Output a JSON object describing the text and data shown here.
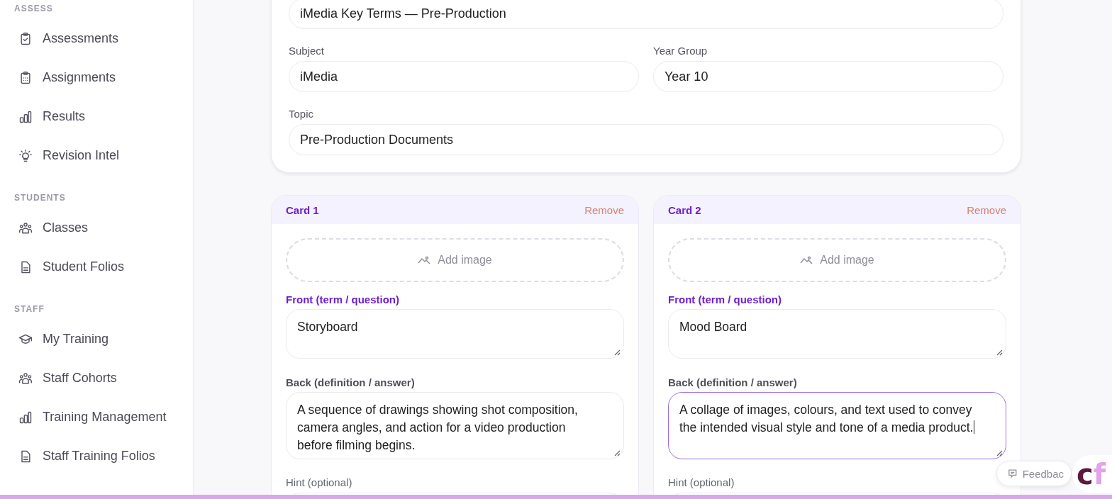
{
  "sidebar": {
    "sections": [
      {
        "heading": "ASSESS",
        "items": [
          {
            "label": "Assessments",
            "kind": "clipboard"
          },
          {
            "label": "Assignments",
            "kind": "checklist"
          },
          {
            "label": "Results",
            "kind": "chart"
          },
          {
            "label": "Revision Intel",
            "kind": "insight"
          }
        ]
      },
      {
        "heading": "STUDENTS",
        "items": [
          {
            "label": "Classes",
            "kind": "group"
          },
          {
            "label": "Student Folios",
            "kind": "folio"
          }
        ]
      },
      {
        "heading": "STAFF",
        "items": [
          {
            "label": "My Training",
            "kind": "training"
          },
          {
            "label": "Staff Cohorts",
            "kind": "group"
          },
          {
            "label": "Training Management",
            "kind": "chart"
          },
          {
            "label": "Staff Training Folios",
            "kind": "folio"
          }
        ]
      }
    ]
  },
  "deck_form": {
    "title_value": "iMedia Key Terms — Pre-Production",
    "fields": [
      {
        "label": "Subject",
        "value": "iMedia"
      },
      {
        "label": "Year Group",
        "value": "Year 10"
      }
    ],
    "topic": {
      "label": "Topic",
      "value": "Pre-Production Documents"
    }
  },
  "cards": [
    {
      "title": "Card 1",
      "remove": "Remove",
      "add_image": "Add image",
      "front_label": "Front (term / question)",
      "front": "Storyboard",
      "back_label": "Back (definition / answer)",
      "back": "A sequence of drawings showing shot composition, camera angles, and action for a video production before filming begins.",
      "back_focused": false,
      "hint_label": "Hint (optional)"
    },
    {
      "title": "Card 2",
      "remove": "Remove",
      "add_image": "Add image",
      "front_label": "Front (term / question)",
      "front": "Mood Board",
      "back_label": "Back (definition / answer)",
      "back": "A collage of images, colours, and text used to convey the intended visual style and tone of a media product.",
      "back_focused": true,
      "hint_label": "Hint (optional)"
    }
  ],
  "feedback": {
    "label": "Feedbac"
  },
  "logo": {
    "letters": [
      {
        "text": "c",
        "color": "#5b1a3c"
      },
      {
        "text": "f",
        "color": "#e2a3ea"
      }
    ]
  }
}
